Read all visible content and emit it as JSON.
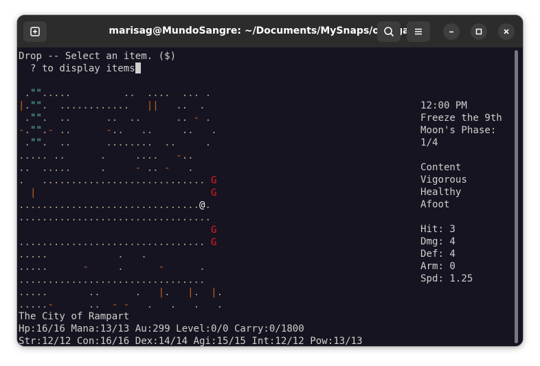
{
  "window": {
    "title": "marisag@MundoSangre: ~/Documents/MySnaps/omega"
  },
  "icons": {
    "new_tab": "new-tab-icon",
    "search": "search-icon",
    "menu": "hamburger-menu-icon",
    "minimize": "minimize-icon",
    "maximize": "maximize-icon",
    "close": "close-icon"
  },
  "colors": {
    "terminal_bg": "#171421",
    "titlebar_bg": "#2c2c2c",
    "text": "#d0cfcc",
    "monster": "#e01b24",
    "map_floor": "#b5a48a",
    "map_highlight": "#56c4a8"
  },
  "prompt": {
    "line1": "Drop -- Select an item. ($)",
    "line2": "  ? to display items"
  },
  "map": {
    "rows": [
      " .\"\".....         ..  ....  ... .",
      "|.\"\".  ............   ||   ..  .",
      " .\"\".  ..      ..  ..      .. - .",
      "-.\"\".- ..      -..   ..     ..   .",
      " .\"\".  ..      ........  ..     .",
      "..... ..      .     ....   -..",
      "..  .....     .     - .. -   .",
      ".   ............................ G",
      "  |                              G",
      "...............................@.",
      ".................................",
      "                                 G",
      "................................ G",
      ".....            .   .",
      ".....      -     .      -      .",
      "................................",
      ".....       ..      .   |.   |.  |.",
      ".....-      ..  - -   .   .   .   ."
    ]
  },
  "status": {
    "time": "12:00 PM",
    "date": "Freeze the 9th",
    "moon_label": "Moon's Phase:",
    "moon_value": "1/4",
    "mood": "Content",
    "vigor": "Vigorous",
    "health": "Healthy",
    "movement": "Afoot",
    "hit": "Hit: 3",
    "dmg": "Dmg: 4",
    "def": "Def: 4",
    "arm": "Arm: 0",
    "spd": "Spd: 1.25"
  },
  "location": "The City of Rampart",
  "stats_line1": "Hp:16/16 Mana:13/13 Au:299 Level:0/0 Carry:0/1800",
  "stats_line2": "Str:12/12 Con:16/16 Dex:14/14 Agi:15/15 Int:12/12 Pow:13/13"
}
